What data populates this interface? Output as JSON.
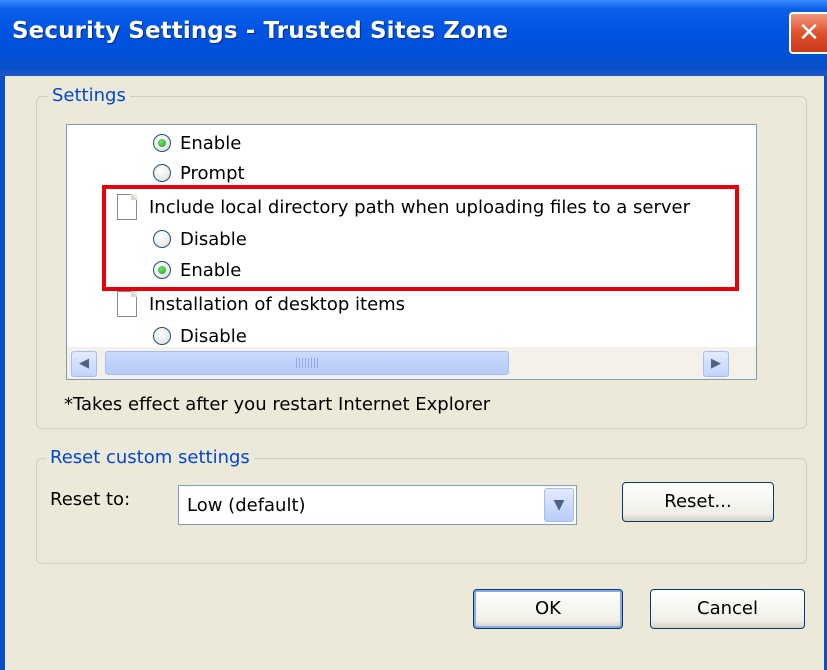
{
  "window": {
    "title": "Security Settings - Trusted Sites Zone",
    "close_glyph": "✕"
  },
  "settings_group": {
    "label": "Settings",
    "rows": [
      {
        "type": "option",
        "label": "Enable",
        "checked": true
      },
      {
        "type": "option",
        "label": "Prompt",
        "checked": false
      },
      {
        "type": "setting",
        "label": "Include local directory path when uploading files to a server"
      },
      {
        "type": "option",
        "label": "Disable",
        "checked": false
      },
      {
        "type": "option",
        "label": "Enable",
        "checked": true
      },
      {
        "type": "setting",
        "label": "Installation of desktop items"
      },
      {
        "type": "option",
        "label": "Disable",
        "checked": false
      }
    ],
    "note": "*Takes effect after you restart Internet Explorer"
  },
  "reset_group": {
    "label": "Reset custom settings",
    "reset_to_label": "Reset to:",
    "reset_to_value": "Low (default)",
    "reset_button": "Reset..."
  },
  "buttons": {
    "ok": "OK",
    "cancel": "Cancel"
  },
  "colors": {
    "highlight": "#e8000b",
    "group_label": "#0046d5",
    "radio_checked": "#21a121"
  }
}
